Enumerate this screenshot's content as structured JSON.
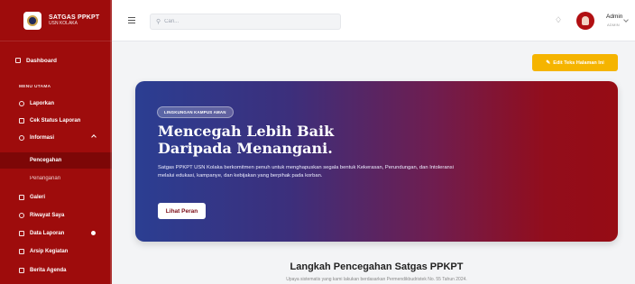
{
  "brand": {
    "title": "SATGAS PPKPT",
    "subtitle": "USN KOLAKA"
  },
  "sidebar": {
    "dashboard": "Dashboard",
    "section_label": "MENU UTAMA",
    "items": {
      "laporkan": "Laporkan",
      "cek_status": "Cek Status Laporan",
      "informasi": "Informasi",
      "pencegahan": "Pencegahan",
      "penanganan": "Penanganan",
      "galeri": "Galeri",
      "riwayat": "Riwayat Saya",
      "data_laporan": "Data Laporan",
      "arsip": "Arsip Kegiatan",
      "berita": "Berita Agenda"
    }
  },
  "topbar": {
    "search_placeholder": "Cari...",
    "user_name": "Admin",
    "user_role": "ADMIN"
  },
  "main": {
    "edit_button": "Edit Teks Halaman Ini",
    "hero": {
      "badge": "LINGKUNGAN KAMPUS AMAN",
      "title_line1": "Mencegah Lebih Baik",
      "title_line2": "Daripada Menangani.",
      "description": "Satgas PPKPT USN Kolaka berkomitmen penuh untuk menghapuskan segala bentuk Kekerasan, Perundungan, dan Intoleransi melalui edukasi, kampanye, dan kebijakan yang berpihak pada korban.",
      "button": "Lihat Peran"
    },
    "section_title": "Langkah Pencegahan Satgas PPKPT",
    "section_subtitle": "Upaya sistematis yang kami lakukan berdasarkan Permendikbudristek No. 55 Tahun 2024."
  },
  "colors": {
    "sidebar_bg": "#9e0c0c",
    "accent_yellow": "#f5b400",
    "hero_start": "#2b3e92",
    "hero_end": "#960c14"
  }
}
